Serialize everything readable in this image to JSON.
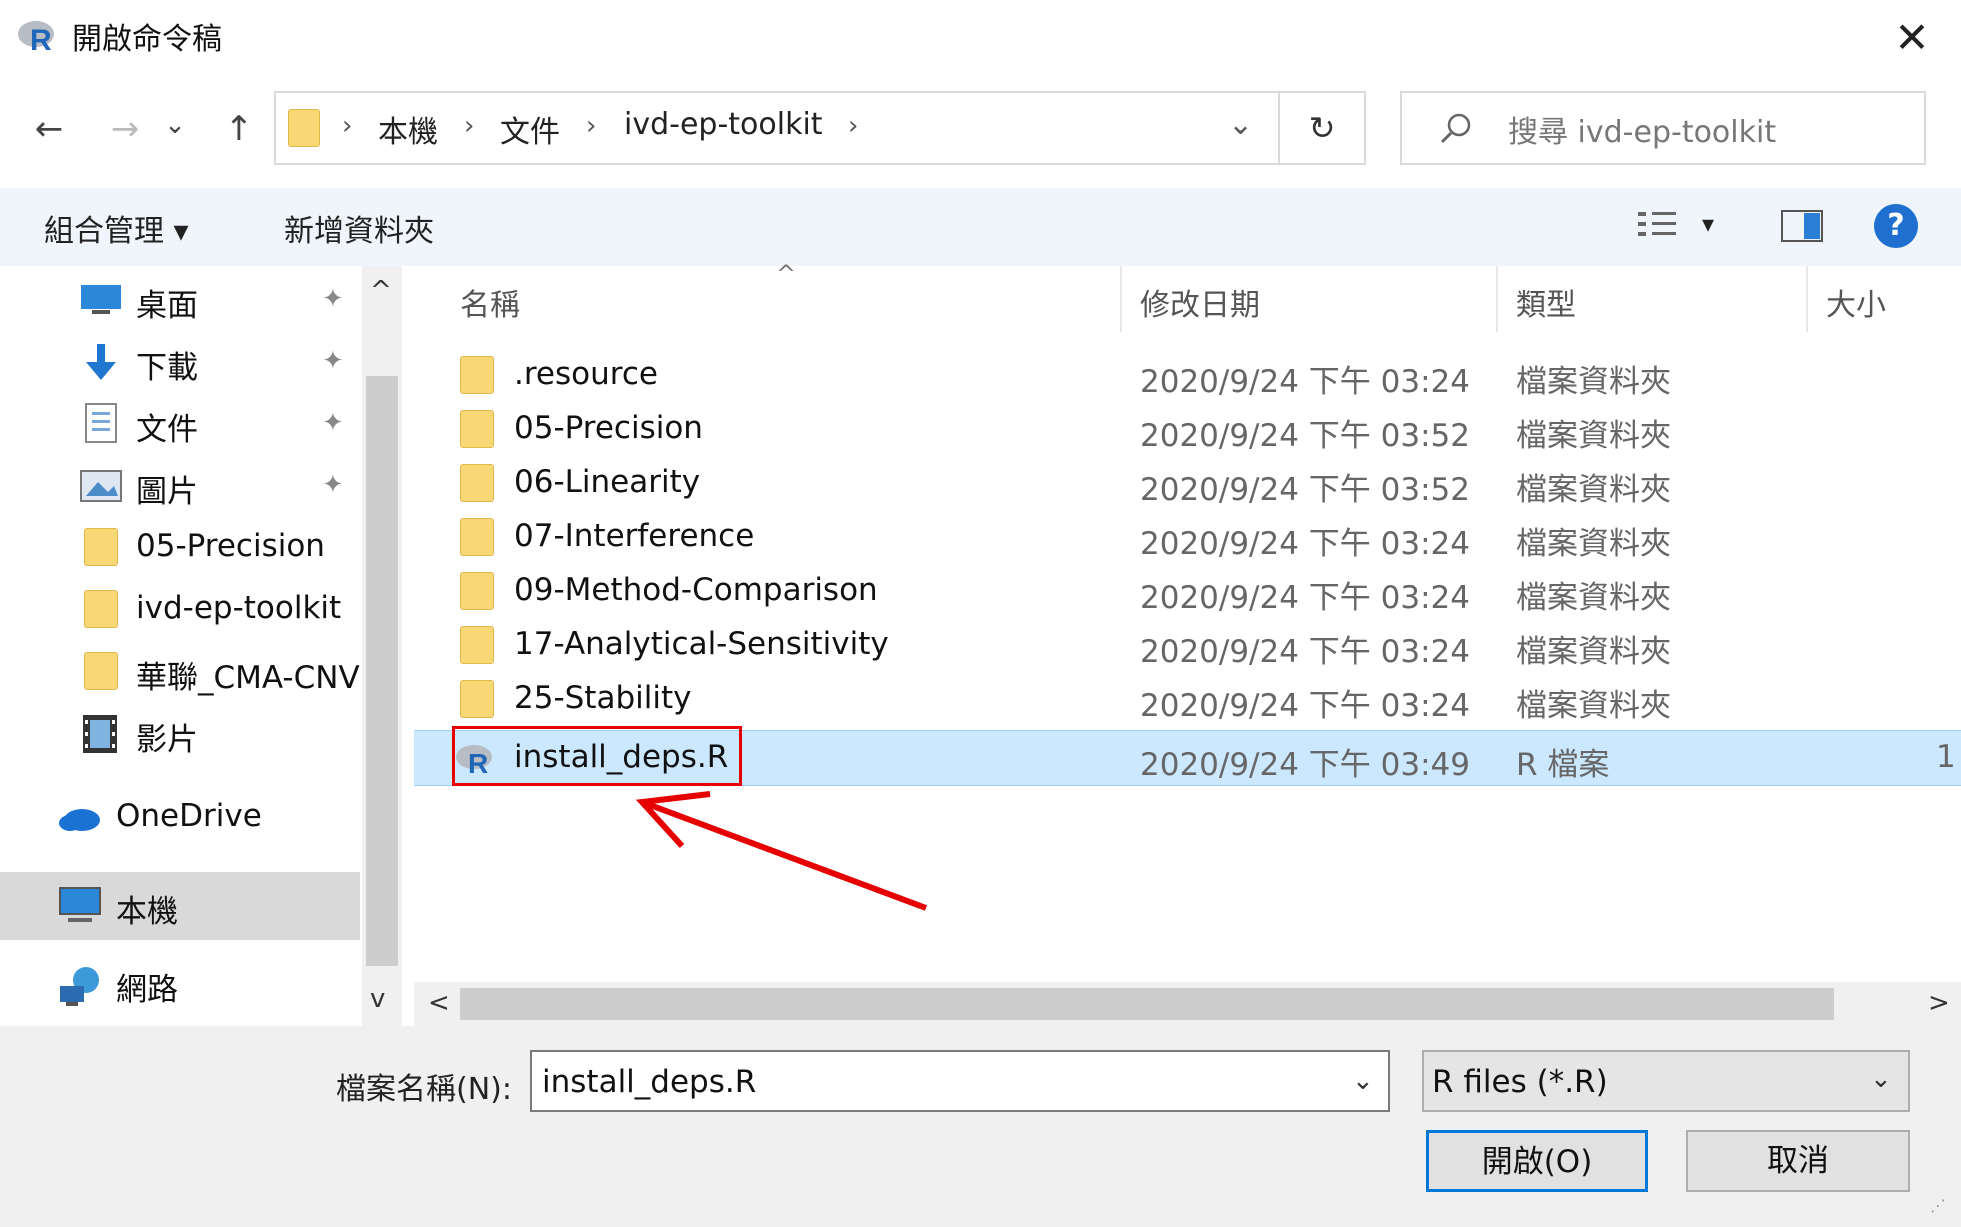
{
  "window": {
    "title": "開啟命令稿",
    "close_glyph": "✕"
  },
  "nav": {
    "back": "←",
    "forward": "→",
    "recent": "⌄",
    "up": "↑"
  },
  "address": {
    "parts": [
      "本機",
      "文件",
      "ivd-ep-toolkit"
    ],
    "sep": "›",
    "dropdown": "⌄",
    "refresh": "↻"
  },
  "search": {
    "placeholder": "搜尋 ivd-ep-toolkit"
  },
  "toolbar": {
    "organize": "組合管理 ▾",
    "new_folder": "新增資料夾",
    "view_arrow": "▾",
    "help": "?"
  },
  "sidebar": {
    "items": [
      {
        "label": "桌面",
        "icon": "desktop-icon",
        "pinned": true
      },
      {
        "label": "下載",
        "icon": "download-icon",
        "pinned": true
      },
      {
        "label": "文件",
        "icon": "documents-icon",
        "pinned": true
      },
      {
        "label": "圖片",
        "icon": "pictures-icon",
        "pinned": true
      },
      {
        "label": "05-Precision",
        "icon": "folder-icon",
        "pinned": false
      },
      {
        "label": "ivd-ep-toolkit",
        "icon": "folder-icon",
        "pinned": false
      },
      {
        "label": "華聯_CMA-CNV",
        "icon": "folder-icon",
        "pinned": false
      },
      {
        "label": "影片",
        "icon": "videos-icon",
        "pinned": false
      },
      {
        "label": "OneDrive",
        "icon": "onedrive-icon",
        "pinned": false
      },
      {
        "label": "本機",
        "icon": "this-pc-icon",
        "pinned": false
      },
      {
        "label": "網路",
        "icon": "network-icon",
        "pinned": false
      }
    ],
    "pin_glyph": "📌"
  },
  "columns": {
    "name": "名稱",
    "date": "修改日期",
    "type": "類型",
    "size": "大小"
  },
  "files": [
    {
      "name": ".resource",
      "date": "2020/9/24 下午 03:24",
      "type": "檔案資料夾",
      "size": ""
    },
    {
      "name": "05-Precision",
      "date": "2020/9/24 下午 03:52",
      "type": "檔案資料夾",
      "size": ""
    },
    {
      "name": "06-Linearity",
      "date": "2020/9/24 下午 03:52",
      "type": "檔案資料夾",
      "size": ""
    },
    {
      "name": "07-Interference",
      "date": "2020/9/24 下午 03:24",
      "type": "檔案資料夾",
      "size": ""
    },
    {
      "name": "09-Method-Comparison",
      "date": "2020/9/24 下午 03:24",
      "type": "檔案資料夾",
      "size": ""
    },
    {
      "name": "17-Analytical-Sensitivity",
      "date": "2020/9/24 下午 03:24",
      "type": "檔案資料夾",
      "size": ""
    },
    {
      "name": "25-Stability",
      "date": "2020/9/24 下午 03:24",
      "type": "檔案資料夾",
      "size": ""
    },
    {
      "name": "install_deps.R",
      "date": "2020/9/24 下午 03:49",
      "type": "R 檔案",
      "size": "1"
    }
  ],
  "footer": {
    "filename_label": "檔案名稱(N):",
    "filename_value": "install_deps.R",
    "filter": "R files (*.R)",
    "open": "開啟(O)",
    "cancel": "取消"
  },
  "scroll": {
    "up": "^",
    "down": "v",
    "left": "<",
    "right": ">"
  },
  "colors": {
    "accent": "#0078d7",
    "selection": "#cce8ff",
    "annotation": "#e60000",
    "folder": "#f8d775"
  }
}
